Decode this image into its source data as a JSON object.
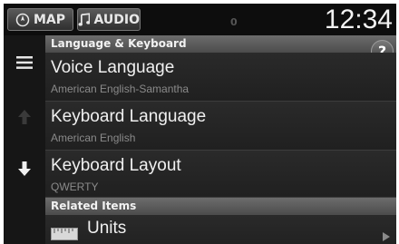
{
  "topbar": {
    "map_label": "MAP",
    "audio_label": "AUDIO",
    "signal_text": "0",
    "clock": "12:34"
  },
  "rail": {
    "icons": [
      "menu-icon",
      "arrow-up-icon",
      "arrow-down-icon"
    ]
  },
  "sections": [
    {
      "header": "Language & Keyboard",
      "items": [
        {
          "title": "Voice Language",
          "subtitle": "American English-Samantha"
        },
        {
          "title": "Keyboard Language",
          "subtitle": "American English"
        },
        {
          "title": "Keyboard Layout",
          "subtitle": "QWERTY"
        }
      ]
    },
    {
      "header": "Related Items",
      "items": [
        {
          "title": "Units",
          "subtitle": "",
          "icon": "ruler-icon"
        }
      ]
    }
  ],
  "help_label": "?",
  "colors": {
    "background": "#1b1b1b",
    "header": "#5c5c5c",
    "text": "#f0f0f0",
    "subtext": "#8a8a8a"
  }
}
